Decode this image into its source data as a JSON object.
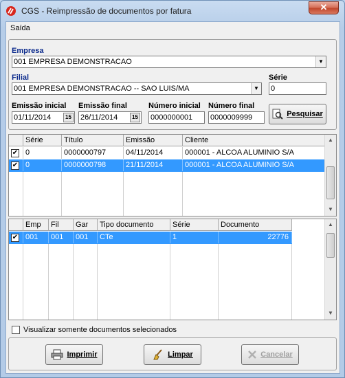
{
  "window": {
    "title": "CGS - Reimpressão de documentos por fatura",
    "close": "✕"
  },
  "menu": {
    "saida": "Saída"
  },
  "filters": {
    "empresa_label": "Empresa",
    "empresa_value": "001 EMPRESA DEMONSTRACAO",
    "filial_label": "Filial",
    "filial_value": "001 EMPRESA DEMONSTRACAO -- SAO LUIS/MA",
    "serie_label": "Série",
    "serie_value": "0",
    "emissao_inicial_label": "Emissão inicial",
    "emissao_inicial_value": "01/11/2014",
    "emissao_final_label": "Emissão final",
    "emissao_final_value": "26/11/2014",
    "numero_inicial_label": "Número inicial",
    "numero_inicial_value": "0000000001",
    "numero_final_label": "Número final",
    "numero_final_value": "0000009999",
    "calendar_glyph": "15",
    "pesquisar_label": "Pesquisar"
  },
  "invoices": {
    "columns": [
      "Série",
      "Título",
      "Emissão",
      "Cliente"
    ],
    "rows": [
      {
        "checked": "✔",
        "serie": "0",
        "titulo": "0000000797",
        "emissao": "04/11/2014",
        "cliente": "000001 - ALCOA ALUMINIO S/A"
      },
      {
        "checked": "✔",
        "serie": "0",
        "titulo": "0000000798",
        "emissao": "21/11/2014",
        "cliente": "000001 - ALCOA ALUMINIO S/A"
      }
    ]
  },
  "documents": {
    "columns": [
      "Emp",
      "Fil",
      "Gar",
      "Tipo documento",
      "Série",
      "Documento"
    ],
    "rows": [
      {
        "checked": "✔",
        "emp": "001",
        "fil": "001",
        "gar": "001",
        "tipo": "CTe",
        "serie": "1",
        "documento": "22776"
      }
    ]
  },
  "options": {
    "only_selected_label": "Visualizar somente documentos selecionados"
  },
  "actions": {
    "imprimir": "Imprimir",
    "limpar": "Limpar",
    "cancelar": "Cancelar"
  }
}
